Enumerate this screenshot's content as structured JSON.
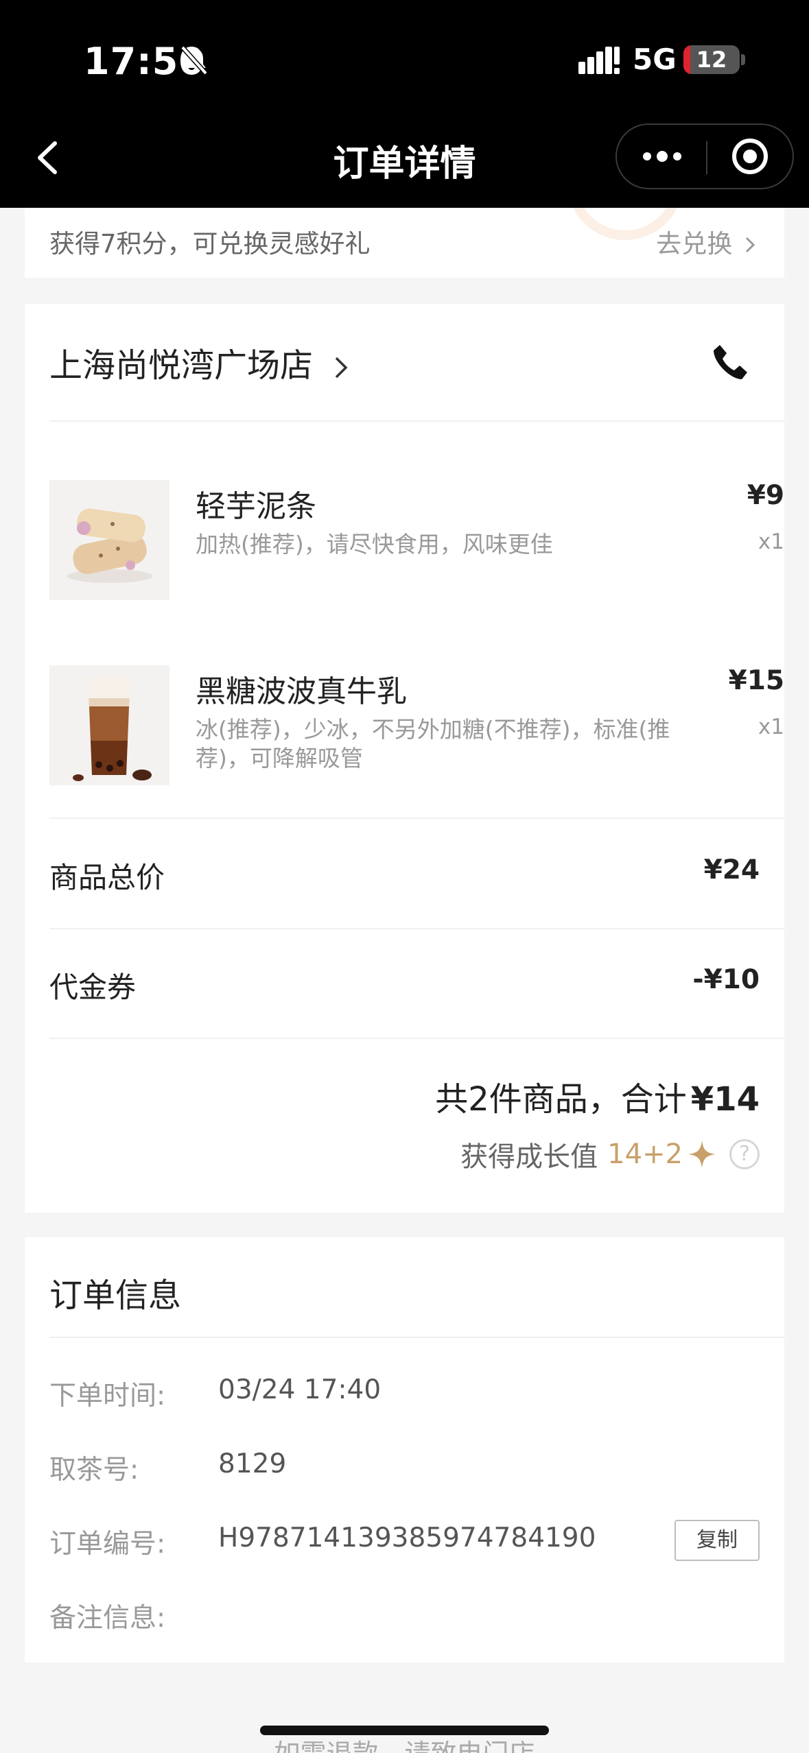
{
  "status_bar": {
    "time": "17:50",
    "network": "5G",
    "battery": "12",
    "battery_level": 0.12
  },
  "nav": {
    "title": "订单详情"
  },
  "points": {
    "text": "获得7积分，可兑换灵感好礼",
    "redeem_label": "去兑换"
  },
  "store": {
    "name": "上海尚悦湾广场店"
  },
  "items": [
    {
      "name": "轻芋泥条",
      "options": "加热(推荐)，请尽快食用，风味更佳",
      "price": "¥9",
      "qty": "x1"
    },
    {
      "name": "黑糖波波真牛乳",
      "options": "冰(推荐)，少冰，不另外加糖(不推荐)，标准(推荐)，可降解吸管",
      "price": "¥15",
      "qty": "x1"
    }
  ],
  "summary": {
    "subtotal_label": "商品总价",
    "subtotal_value": "¥24",
    "coupon_label": "代金券",
    "coupon_value": "-¥10",
    "total_prefix": "共2件商品，合计",
    "total_value": "¥14",
    "growth_label": "获得成长值",
    "growth_value": "14+2"
  },
  "order_info": {
    "title": "订单信息",
    "rows": [
      {
        "label": "下单时间:",
        "value": "03/24 17:40"
      },
      {
        "label": "取茶号:",
        "value": "8129"
      },
      {
        "label": "订单编号:",
        "value": "H978714139385974784190"
      },
      {
        "label": "备注信息:",
        "value": ""
      }
    ],
    "copy_label": "复制"
  },
  "footer": {
    "note": "如需退款，请致电门店"
  },
  "colors": {
    "accent_gold": "#c8a06a",
    "top_bar": "#000000",
    "battery_low": "#e0232e"
  },
  "icons": [
    "bell-slash-icon",
    "signal-icon",
    "back-chevron-icon",
    "more-dots-icon",
    "target-icon",
    "chevron-right-icon",
    "phone-icon",
    "sparkle-icon",
    "help-icon"
  ]
}
